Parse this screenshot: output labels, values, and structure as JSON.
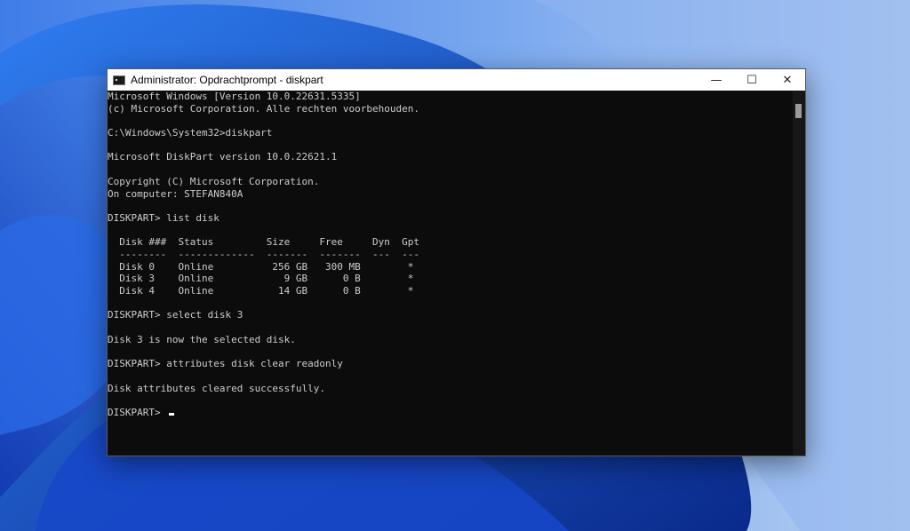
{
  "window": {
    "title": "Administrator: Opdrachtprompt - diskpart",
    "minimize_icon": "minimize-icon",
    "maximize_icon": "maximize-icon",
    "close_icon": "close-icon"
  },
  "console": {
    "lines": [
      "Microsoft Windows [Version 10.0.22631.5335]",
      "(c) Microsoft Corporation. Alle rechten voorbehouden.",
      "",
      "C:\\Windows\\System32>diskpart",
      "",
      "Microsoft DiskPart version 10.0.22621.1",
      "",
      "Copyright (C) Microsoft Corporation.",
      "On computer: STEFAN840A",
      "",
      "DISKPART> list disk",
      "",
      "  Disk ###  Status         Size     Free     Dyn  Gpt",
      "  --------  -------------  -------  -------  ---  ---",
      "  Disk 0    Online          256 GB   300 MB        *",
      "  Disk 3    Online            9 GB      0 B        *",
      "  Disk 4    Online           14 GB      0 B        *",
      "",
      "DISKPART> select disk 3",
      "",
      "Disk 3 is now the selected disk.",
      "",
      "DISKPART> attributes disk clear readonly",
      "",
      "Disk attributes cleared successfully.",
      "",
      "DISKPART> "
    ]
  },
  "colors": {
    "console_bg": "#0c0c0c",
    "console_fg": "#cccccc",
    "wallpaper_blue": "#1446c4"
  }
}
